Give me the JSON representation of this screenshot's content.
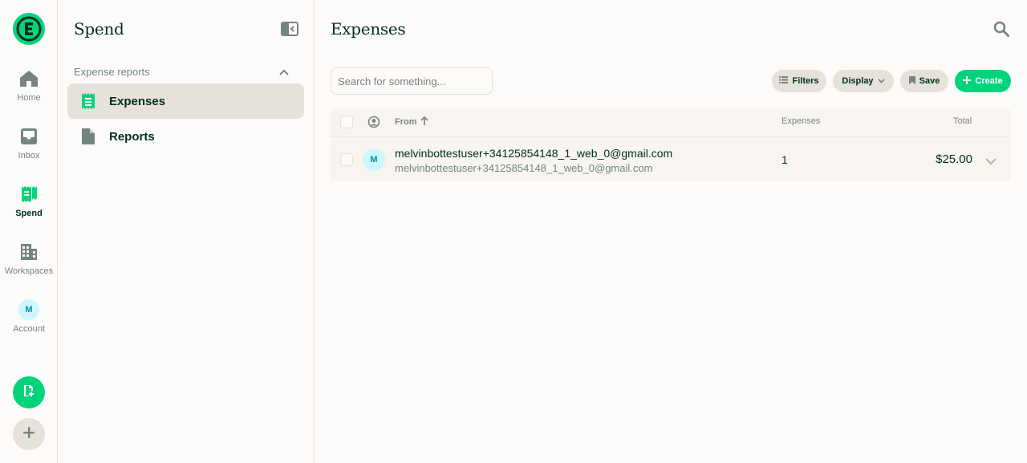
{
  "rail": {
    "items": [
      {
        "label": "Home",
        "icon": "home-icon"
      },
      {
        "label": "Inbox",
        "icon": "inbox-icon"
      },
      {
        "label": "Spend",
        "icon": "receipt-icon"
      },
      {
        "label": "Workspaces",
        "icon": "building-icon"
      },
      {
        "label": "Account",
        "avatar": "M"
      }
    ]
  },
  "sidebar": {
    "title": "Spend",
    "section_label": "Expense reports",
    "items": [
      {
        "label": "Expenses",
        "icon": "receipt-icon"
      },
      {
        "label": "Reports",
        "icon": "document-icon"
      }
    ]
  },
  "main": {
    "title": "Expenses",
    "search_placeholder": "Search for something...",
    "toolbar": {
      "filters": "Filters",
      "display": "Display",
      "save": "Save",
      "create": "Create"
    },
    "table": {
      "headers": {
        "from": "From",
        "expenses": "Expenses",
        "total": "Total"
      },
      "rows": [
        {
          "avatar": "M",
          "from_primary": "melvinbottestuser+34125854148_1_web_0@gmail.com",
          "from_secondary": "melvinbottestuser+34125854148_1_web_0@gmail.com",
          "expenses": "1",
          "total": "$25.00"
        }
      ]
    }
  },
  "colors": {
    "brand_green": "#03d47c",
    "text_dark": "#002e22",
    "text_muted": "#76847e",
    "border": "#e6e1da",
    "background": "#fcfbf9"
  }
}
